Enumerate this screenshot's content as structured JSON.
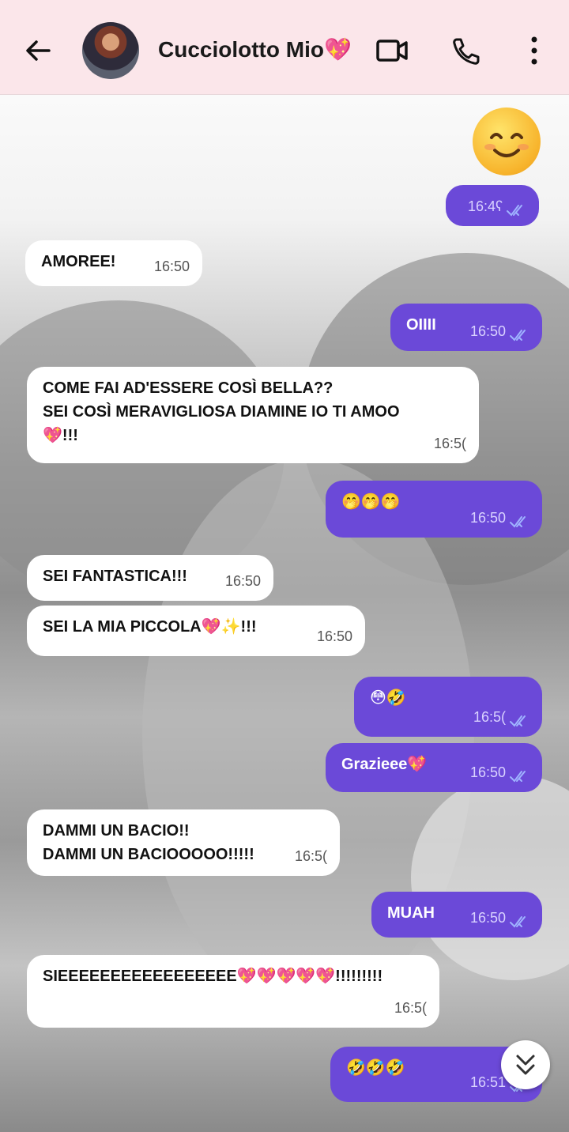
{
  "header": {
    "title": "Cucciolotto Mio💖",
    "back_icon": "arrow-left-icon",
    "video_icon": "video-camera-icon",
    "call_icon": "phone-icon",
    "menu_icon": "more-vertical-icon",
    "bg_color": "#fbe6ea"
  },
  "messages": [
    {
      "dir": "out",
      "text": "☺️",
      "time": "16:4ʕ",
      "read": true
    },
    {
      "dir": "in",
      "text": "AMOREE!",
      "time": "16:50"
    },
    {
      "dir": "out",
      "text": "OIIII",
      "time": "16:50",
      "read": true
    },
    {
      "dir": "in",
      "text": "COME FAI AD'ESSERE COSÌ BELLA??\nSEI COSÌ MERAVIGLIOSA DIAMINE IO TI AMOO\n💖!!!",
      "time": "16:5("
    },
    {
      "dir": "out",
      "text": "🤭🤭🤭",
      "time": "16:50",
      "read": true
    },
    {
      "dir": "in",
      "text": "SEI FANTASTICA!!!",
      "time": "16:50"
    },
    {
      "dir": "in",
      "text": "SEI LA MIA PICCOLA💖✨!!!",
      "time": "16:50"
    },
    {
      "dir": "out",
      "text": "😳🤣",
      "time": "16:5(",
      "read": true
    },
    {
      "dir": "out",
      "text": "Grazieee💖",
      "time": "16:50",
      "read": true
    },
    {
      "dir": "in",
      "text": "DAMMI UN BACIO!!\nDAMMI UN BACIOOOOO!!!!!",
      "time": "16:5("
    },
    {
      "dir": "out",
      "text": "MUAH",
      "time": "16:50",
      "read": true
    },
    {
      "dir": "in",
      "text": "SIEEEEEEEEEEEEEEEEE💖💖💖💖💖!!!!!!!!!",
      "time": "16:5("
    },
    {
      "dir": "out",
      "text": "🤣🤣🤣",
      "time": "16:51",
      "read": true
    }
  ],
  "colors": {
    "outgoing": "#6b49d8",
    "incoming": "#ffffff",
    "ticks": "#9fb3ff"
  },
  "scroll_fab_icon": "double-chevron-down-icon"
}
